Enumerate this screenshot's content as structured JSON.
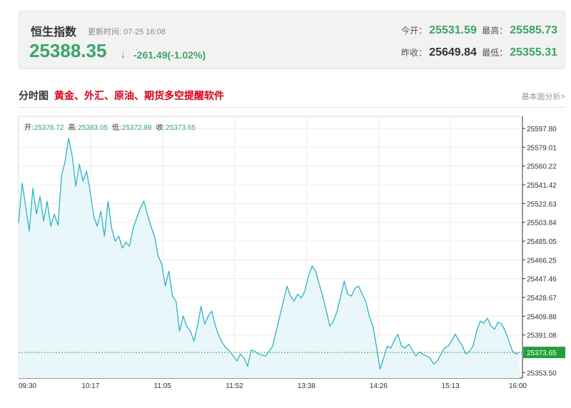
{
  "quote": {
    "name": "恒生指数",
    "update_time": "更新时间: 07-25 16:08",
    "price": "25388.35",
    "arrow": "↓",
    "change": "-261.49(-1.02%)",
    "open_label": "今开：",
    "open": "25531.59",
    "high_label": "最高：",
    "high": "25585.73",
    "prev_close_label": "昨收：",
    "prev_close": "25649.84",
    "low_label": "最低：",
    "low": "25355.31"
  },
  "section": {
    "title": "分时图",
    "promo": "黄金、外汇、原油、期货多空提醒软件",
    "basic_link": "基本面分析>"
  },
  "colors": {
    "line": "#29b5c5",
    "fill": "#eaf7fa",
    "up_green": "#3aa56a",
    "ref_line": "#2fa84f",
    "badge": "#23a03a",
    "promo_red": "#d9001b"
  },
  "chart_data": {
    "type": "area",
    "ohlc_labels": {
      "open_label": "开:",
      "open": "25376.72",
      "high_label": "高:",
      "high": "25383.05",
      "low_label": "低:",
      "low": "25372.89",
      "close_label": "收:",
      "close": "25373.65"
    },
    "y_ticks": [
      "25597.80",
      "25579.01",
      "25560.22",
      "25541.42",
      "25522.63",
      "25503.84",
      "25485.05",
      "25466.25",
      "25447.46",
      "25428.67",
      "25409.88",
      "25391.08",
      "25353.50"
    ],
    "x_ticks": [
      "09:30",
      "10:17",
      "11:05",
      "11:52",
      "13:38",
      "14:26",
      "15:13",
      "16:00"
    ],
    "ylim": [
      25348.0,
      25610.0
    ],
    "reference_value": 25373.65,
    "reference_label": "25373.65",
    "grid": true,
    "points": [
      [
        0,
        25503
      ],
      [
        1,
        25543
      ],
      [
        2,
        25520
      ],
      [
        3,
        25495
      ],
      [
        4,
        25538
      ],
      [
        5,
        25512
      ],
      [
        6,
        25530
      ],
      [
        7,
        25505
      ],
      [
        8,
        25525
      ],
      [
        9,
        25500
      ],
      [
        10,
        25512
      ],
      [
        11,
        25501
      ],
      [
        12,
        25550
      ],
      [
        13,
        25565
      ],
      [
        14,
        25588
      ],
      [
        15,
        25570
      ],
      [
        16,
        25540
      ],
      [
        17,
        25562
      ],
      [
        18,
        25545
      ],
      [
        19,
        25555
      ],
      [
        20,
        25535
      ],
      [
        21,
        25510
      ],
      [
        22,
        25500
      ],
      [
        23,
        25515
      ],
      [
        24,
        25490
      ],
      [
        25,
        25525
      ],
      [
        26,
        25498
      ],
      [
        27,
        25485
      ],
      [
        28,
        25490
      ],
      [
        29,
        25478
      ],
      [
        30,
        25484
      ],
      [
        31,
        25480
      ],
      [
        32,
        25498
      ],
      [
        33,
        25508
      ],
      [
        34,
        25518
      ],
      [
        35,
        25525
      ],
      [
        36,
        25512
      ],
      [
        37,
        25500
      ],
      [
        38,
        25490
      ],
      [
        39,
        25470
      ],
      [
        40,
        25462
      ],
      [
        41,
        25440
      ],
      [
        42,
        25455
      ],
      [
        43,
        25430
      ],
      [
        44,
        25425
      ],
      [
        45,
        25395
      ],
      [
        46,
        25410
      ],
      [
        47,
        25400
      ],
      [
        48,
        25395
      ],
      [
        49,
        25385
      ],
      [
        50,
        25400
      ],
      [
        51,
        25420
      ],
      [
        52,
        25402
      ],
      [
        53,
        25410
      ],
      [
        54,
        25415
      ],
      [
        55,
        25400
      ],
      [
        56,
        25390
      ],
      [
        57,
        25383
      ],
      [
        58,
        25378
      ],
      [
        59,
        25375
      ],
      [
        60,
        25370
      ],
      [
        61,
        25365
      ],
      [
        62,
        25372
      ],
      [
        63,
        25368
      ],
      [
        64,
        25360
      ],
      [
        65,
        25376
      ],
      [
        66,
        25375
      ],
      [
        67,
        25372
      ],
      [
        68,
        25371
      ],
      [
        69,
        25370
      ],
      [
        70,
        25375
      ],
      [
        71,
        25380
      ],
      [
        72,
        25395
      ],
      [
        73,
        25410
      ],
      [
        74,
        25425
      ],
      [
        75,
        25440
      ],
      [
        76,
        25430
      ],
      [
        77,
        25425
      ],
      [
        78,
        25432
      ],
      [
        79,
        25428
      ],
      [
        80,
        25435
      ],
      [
        81,
        25450
      ],
      [
        82,
        25460
      ],
      [
        83,
        25455
      ],
      [
        84,
        25442
      ],
      [
        85,
        25430
      ],
      [
        86,
        25415
      ],
      [
        87,
        25400
      ],
      [
        88,
        25405
      ],
      [
        89,
        25415
      ],
      [
        90,
        25430
      ],
      [
        91,
        25445
      ],
      [
        92,
        25432
      ],
      [
        93,
        25430
      ],
      [
        94,
        25438
      ],
      [
        95,
        25440
      ],
      [
        96,
        25432
      ],
      [
        97,
        25425
      ],
      [
        98,
        25410
      ],
      [
        99,
        25400
      ],
      [
        100,
        25380
      ],
      [
        101,
        25357
      ],
      [
        102,
        25368
      ],
      [
        103,
        25380
      ],
      [
        104,
        25378
      ],
      [
        105,
        25386
      ],
      [
        106,
        25392
      ],
      [
        107,
        25380
      ],
      [
        108,
        25378
      ],
      [
        109,
        25382
      ],
      [
        110,
        25376
      ],
      [
        111,
        25370
      ],
      [
        112,
        25374
      ],
      [
        113,
        25372
      ],
      [
        114,
        25370
      ],
      [
        115,
        25368
      ],
      [
        116,
        25362
      ],
      [
        117,
        25365
      ],
      [
        118,
        25372
      ],
      [
        119,
        25378
      ],
      [
        120,
        25380
      ],
      [
        121,
        25385
      ],
      [
        122,
        25392
      ],
      [
        123,
        25386
      ],
      [
        124,
        25380
      ],
      [
        125,
        25372
      ],
      [
        126,
        25375
      ],
      [
        127,
        25380
      ],
      [
        128,
        25395
      ],
      [
        129,
        25405
      ],
      [
        130,
        25403
      ],
      [
        131,
        25408
      ],
      [
        132,
        25400
      ],
      [
        133,
        25397
      ],
      [
        134,
        25404
      ],
      [
        135,
        25402
      ],
      [
        136,
        25395
      ],
      [
        137,
        25385
      ],
      [
        138,
        25375
      ],
      [
        139,
        25372
      ],
      [
        140,
        25374
      ]
    ]
  }
}
